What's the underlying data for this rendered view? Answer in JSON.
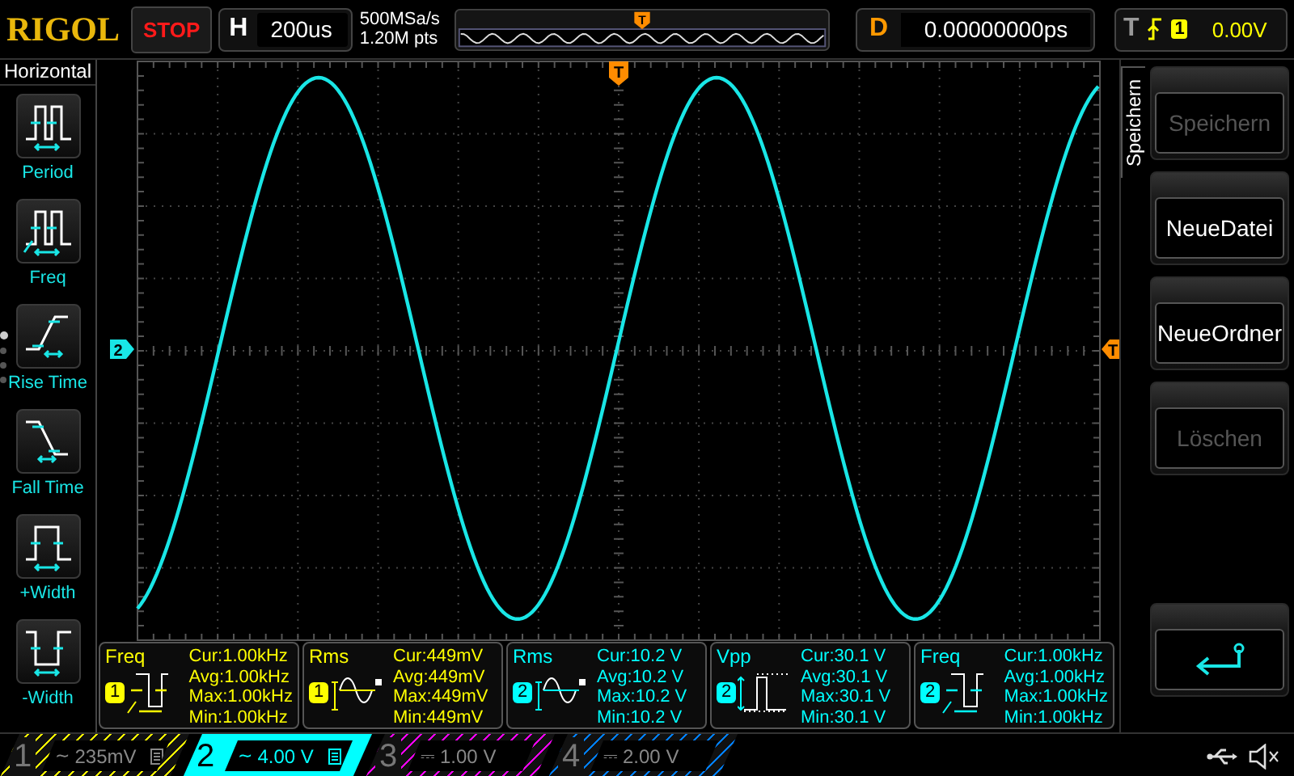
{
  "brand": {
    "logo": "RIGOL"
  },
  "run_state": {
    "label": "STOP"
  },
  "timebase": {
    "label": "H",
    "value": "200us"
  },
  "acquisition": {
    "sample_rate": "500MSa/s",
    "memory_depth": "1.20M pts"
  },
  "memory_overview": {
    "marker": "T"
  },
  "delay": {
    "label": "D",
    "value": "0.00000000ps"
  },
  "trigger": {
    "label": "T",
    "source": "1",
    "value": "0.00V"
  },
  "sidebar": {
    "title": "Horizontal",
    "items": [
      {
        "label": "Period",
        "kind": "period"
      },
      {
        "label": "Freq",
        "kind": "freq"
      },
      {
        "label": "Rise Time",
        "kind": "rise"
      },
      {
        "label": "Fall Time",
        "kind": "fall"
      },
      {
        "label": "+Width",
        "kind": "pwidth"
      },
      {
        "label": "-Width",
        "kind": "nwidth"
      }
    ],
    "pages": [
      {
        "selected": true
      },
      {
        "selected": false
      },
      {
        "selected": false
      },
      {
        "selected": false
      }
    ]
  },
  "graticule": {
    "channel_marker": "2",
    "trigger_level_marker": "T",
    "trigger_position_marker": "T"
  },
  "side_menu": {
    "tab": "Speichern",
    "buttons": [
      {
        "kind": "text",
        "label": "Speichern",
        "disabled": true
      },
      {
        "kind": "text",
        "label": "NeueDatei",
        "disabled": false
      },
      {
        "kind": "text",
        "label": "NeueOrdner",
        "disabled": false
      },
      {
        "kind": "text",
        "label": "Löschen",
        "disabled": true
      },
      {
        "kind": "back"
      }
    ]
  },
  "measurements": [
    {
      "name": "Freq",
      "channel": "1",
      "color": "#ffff00",
      "kind": "freq",
      "lines": [
        "Cur:1.00kHz",
        "Avg:1.00kHz",
        "Max:1.00kHz",
        "Min:1.00kHz"
      ]
    },
    {
      "name": "Rms",
      "channel": "1",
      "color": "#ffff00",
      "kind": "rms",
      "lines": [
        "Cur:449mV",
        "Avg:449mV",
        "Max:449mV",
        "Min:449mV"
      ]
    },
    {
      "name": "Rms",
      "channel": "2",
      "color": "#00ffff",
      "kind": "rms",
      "lines": [
        "Cur:10.2 V",
        "Avg:10.2 V",
        "Max:10.2 V",
        "Min:10.2 V"
      ]
    },
    {
      "name": "Vpp",
      "channel": "2",
      "color": "#00ffff",
      "kind": "vpp",
      "lines": [
        "Cur:30.1 V",
        "Avg:30.1 V",
        "Max:30.1 V",
        "Min:30.1 V"
      ]
    },
    {
      "name": "Freq",
      "channel": "2",
      "color": "#00ffff",
      "kind": "freq",
      "lines": [
        "Cur:1.00kHz",
        "Avg:1.00kHz",
        "Max:1.00kHz",
        "Min:1.00kHz"
      ]
    }
  ],
  "channels": [
    {
      "number": "1",
      "coupling": "~",
      "scale": "235mV",
      "bw_limit": true,
      "color": "#ffff00",
      "selected": false
    },
    {
      "number": "2",
      "coupling": "~",
      "scale": "4.00 V",
      "bw_limit": true,
      "color": "#00ffff",
      "selected": true
    },
    {
      "number": "3",
      "coupling": "⎓",
      "scale": "1.00 V",
      "bw_limit": false,
      "color": "#ff00ff",
      "selected": false
    },
    {
      "number": "4",
      "coupling": "⎓",
      "scale": "2.00 V",
      "bw_limit": false,
      "color": "#0080ff",
      "selected": false
    }
  ]
}
